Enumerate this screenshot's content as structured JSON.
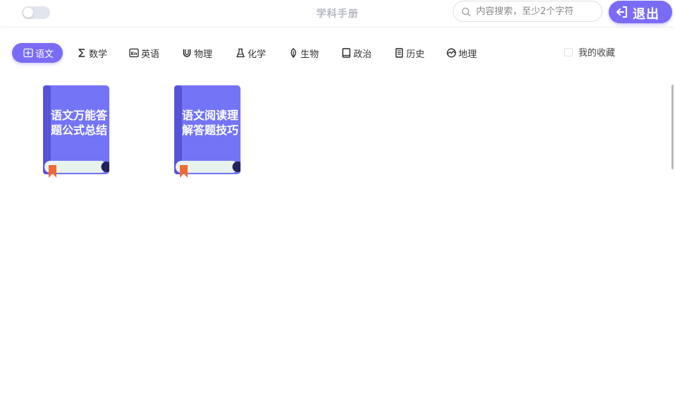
{
  "header": {
    "title": "学科手册",
    "search": {
      "placeholder": "内容搜索，至少2个字符",
      "value": ""
    },
    "logout_label": "退出",
    "theme_toggle_on": false
  },
  "tabs": [
    {
      "label": "语文",
      "icon": "book-open-icon",
      "active": true
    },
    {
      "label": "数学",
      "icon": "sigma-icon",
      "active": false
    },
    {
      "label": "英语",
      "icon": "en-icon",
      "active": false
    },
    {
      "label": "物理",
      "icon": "magnet-icon",
      "active": false
    },
    {
      "label": "化学",
      "icon": "flask-icon",
      "active": false
    },
    {
      "label": "生物",
      "icon": "leaf-icon",
      "active": false
    },
    {
      "label": "政治",
      "icon": "book-icon",
      "active": false
    },
    {
      "label": "历史",
      "icon": "scroll-icon",
      "active": false
    },
    {
      "label": "地理",
      "icon": "globe-icon",
      "active": false
    }
  ],
  "favorites": {
    "label": "我的收藏",
    "checked": false
  },
  "books": [
    {
      "title": "语文万能答题公式总结"
    },
    {
      "title": "语文阅读理解答题技巧"
    }
  ],
  "colors": {
    "accent": "#7b6cf6",
    "book_cover": "#7474f6",
    "book_spine": "#5753d8",
    "book_pages": "#e8f3ee",
    "bookmark": "#f06a35"
  }
}
